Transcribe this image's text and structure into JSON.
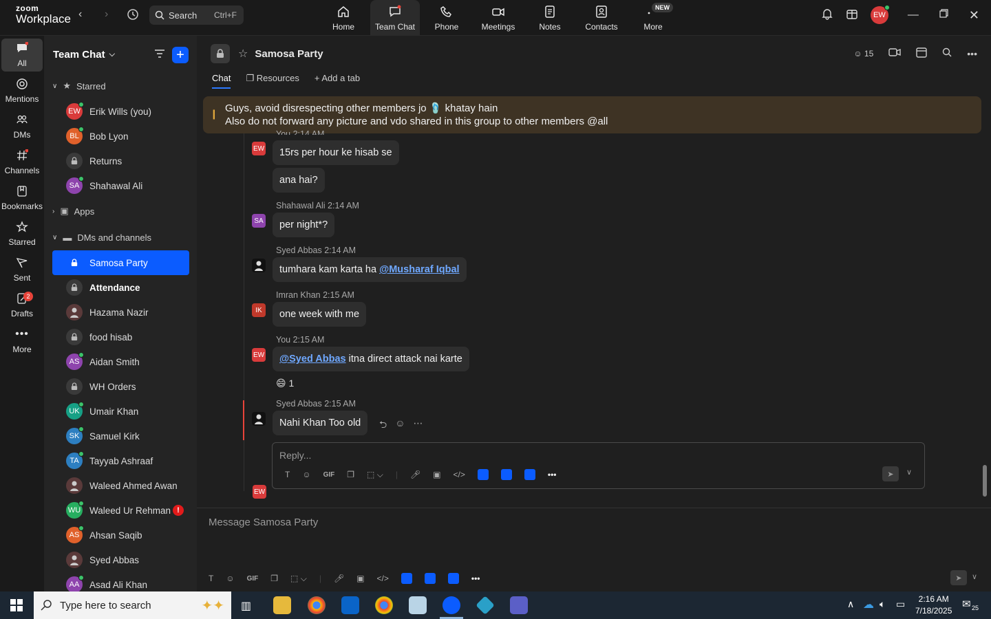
{
  "app": {
    "brand_top": "zoom",
    "brand_bottom": "Workplace"
  },
  "search": {
    "label": "Search",
    "shortcut": "Ctrl+F"
  },
  "topnav": [
    {
      "label": "Home",
      "icon": "home-icon"
    },
    {
      "label": "Team Chat",
      "icon": "chat-icon"
    },
    {
      "label": "Phone",
      "icon": "phone-icon"
    },
    {
      "label": "Meetings",
      "icon": "video-icon"
    },
    {
      "label": "Notes",
      "icon": "notes-icon"
    },
    {
      "label": "Contacts",
      "icon": "contacts-icon"
    },
    {
      "label": "More",
      "icon": "more-icon",
      "badge": "NEW"
    }
  ],
  "user": {
    "initials": "EW",
    "color": "#d93b3b"
  },
  "rail": [
    {
      "label": "All"
    },
    {
      "label": "Mentions"
    },
    {
      "label": "DMs"
    },
    {
      "label": "Channels"
    },
    {
      "label": "Bookmarks"
    },
    {
      "label": "Starred"
    },
    {
      "label": "Sent"
    },
    {
      "label": "Drafts",
      "badge": "2"
    },
    {
      "label": "More"
    }
  ],
  "sidebar": {
    "title": "Team Chat",
    "sections": {
      "starred": "Starred",
      "apps": "Apps",
      "dms": "DMs and channels"
    },
    "starred": [
      {
        "name": "Erik Wills (you)",
        "initials": "EW",
        "color": "#d93b3b",
        "type": "avatar"
      },
      {
        "name": "Bob Lyon",
        "initials": "BL",
        "color": "#e0612b",
        "type": "avatar"
      },
      {
        "name": "Returns",
        "type": "lock"
      },
      {
        "name": "Shahawal Ali",
        "initials": "SA",
        "color": "#8e44ad",
        "type": "avatar"
      }
    ],
    "channels": [
      {
        "name": "Samosa Party",
        "type": "lock",
        "selected": true
      },
      {
        "name": "Attendance",
        "type": "lock",
        "bold": true
      },
      {
        "name": "Hazama Nazir",
        "type": "photo"
      },
      {
        "name": "food hisab",
        "type": "lock"
      },
      {
        "name": "Aidan Smith",
        "initials": "AS",
        "color": "#8e44ad",
        "type": "avatar"
      },
      {
        "name": "WH Orders",
        "type": "lock"
      },
      {
        "name": "Umair Khan",
        "initials": "UK",
        "color": "#16a085",
        "type": "avatar"
      },
      {
        "name": "Samuel Kirk",
        "initials": "SK",
        "color": "#2d7fc1",
        "type": "avatar"
      },
      {
        "name": "Tayyab Ashraaf",
        "initials": "TA",
        "color": "#2d7fc1",
        "type": "avatar"
      },
      {
        "name": "Waleed Ahmed Awan",
        "type": "photo"
      },
      {
        "name": "Waleed Ur Rehman",
        "initials": "WU",
        "color": "#27ae60",
        "type": "avatar",
        "alert": "!"
      },
      {
        "name": "Ahsan Saqib",
        "initials": "AS",
        "color": "#e0612b",
        "type": "avatar"
      },
      {
        "name": "Syed Abbas",
        "type": "photo"
      },
      {
        "name": "Asad Ali Khan",
        "initials": "AA",
        "color": "#8e44ad",
        "type": "avatar"
      }
    ]
  },
  "channel": {
    "title": "Samosa Party",
    "members": "15",
    "tabs": [
      "Chat",
      "Resources",
      "Add a tab"
    ],
    "pinned_line1": "Guys, avoid disrespecting other members jo 🩴 khatay hain",
    "pinned_line2": "Also do not forward any picture and vdo shared in this group to other members @all"
  },
  "messages": [
    {
      "meta": "You 2:14 AM",
      "text": "15rs per hour ke hisab se",
      "initials": "EW"
    },
    {
      "text": "ana hai?"
    },
    {
      "meta": "Shahawal Ali 2:14 AM",
      "text": "per night*?",
      "initials": "SA"
    },
    {
      "meta": "Syed Abbas 2:14 AM",
      "text": "tumhara kam karta ha ",
      "mention": "@Musharaf Iqbal"
    },
    {
      "meta": "Imran Khan 2:15 AM",
      "text": "one week with me",
      "initials": "IK"
    },
    {
      "meta": "You 2:15 AM",
      "mention": "@Syed Abbas",
      "text": " itna direct attack nai karte",
      "initials": "EW",
      "reaction": "😄 1"
    },
    {
      "meta": "Syed Abbas 2:15 AM",
      "text": "Nahi Khan Too old"
    }
  ],
  "reply": {
    "placeholder": "Reply...",
    "initials": "EW"
  },
  "composer": {
    "placeholder": "Message Samosa Party"
  },
  "taskbar": {
    "search_placeholder": "Type here to search",
    "time": "2:16 AM",
    "date": "7/18/2025",
    "notif_count": "25"
  }
}
